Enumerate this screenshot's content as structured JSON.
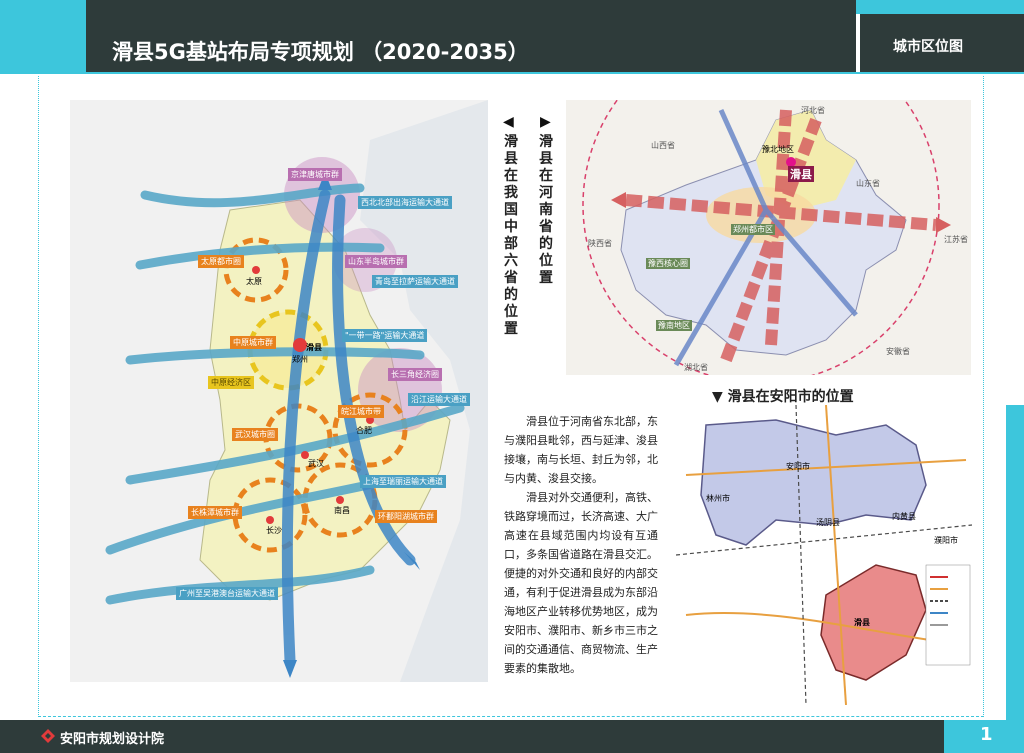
{
  "header": {
    "title": "滑县5G基站布局专项规划  （2020-2035）",
    "section": "城市区位图"
  },
  "footer": {
    "org": "安阳市规划设计院",
    "page": "1"
  },
  "captions": {
    "china_left_arrow": "◀",
    "china": "滑县在我国中部六省的位置",
    "henan_right_arrow": "▶",
    "henan": "滑县在河南省的位置",
    "anyang_arrow": "▼",
    "anyang": "滑县在安阳市的位置"
  },
  "description": [
    "滑县位于河南省东北部，东与濮阳县毗邻，西与延津、浚县接壤，南与长垣、封丘为邻，北与内黄、浚县交接。",
    "滑县对外交通便利，高铁、铁路穿境而过，长济高速、大广高速在县域范围内均设有互通口，多条国省道路在滑县交汇。便捷的对外交通和良好的内部交通，有利于促进滑县成为东部沿海地区产业转移优势地区，成为安阳市、濮阳市、新乡市三市之间的交通通信、商贸物流、生产要素的集散地。"
  ],
  "china_map": {
    "corridors": [
      "京津唐城市群",
      "西北北部出海运输大通道",
      "山东半岛城市群",
      "青岛至拉萨运输大通道",
      "\"一带一路\"运输大通道",
      "长三角经济圈",
      "沿江运输大通道",
      "上海至瑞丽运输大通道",
      "环鄱阳湖城市群",
      "广州至吴港澳台运输大通道"
    ],
    "clusters": [
      "太原都市圈",
      "中原城市群",
      "中原经济区",
      "皖江城市带",
      "武汉城市圈",
      "长株潭城市群"
    ],
    "cities": [
      "太原",
      "滑县",
      "郑州",
      "合肥",
      "武汉",
      "长沙",
      "南昌"
    ]
  },
  "henan_map": {
    "provinces": [
      "河北省",
      "山西省",
      "山东省",
      "江苏省",
      "陕西省",
      "湖北省",
      "安徽省"
    ],
    "labels": [
      "滑县",
      "豫北地区",
      "郑州都市区",
      "豫西核心圈",
      "豫南地区"
    ]
  },
  "anyang_map": {
    "places": [
      "林州市",
      "安阳市",
      "汤阴县",
      "内黄县",
      "滑县",
      "濮阳市"
    ]
  },
  "colors": {
    "header_bg": "#2e3b3a",
    "accent": "#3dc6dc",
    "corridor_blue": "#3d86c6",
    "cluster_orange": "#e8821e",
    "highlight_pink": "#e87a7a"
  }
}
